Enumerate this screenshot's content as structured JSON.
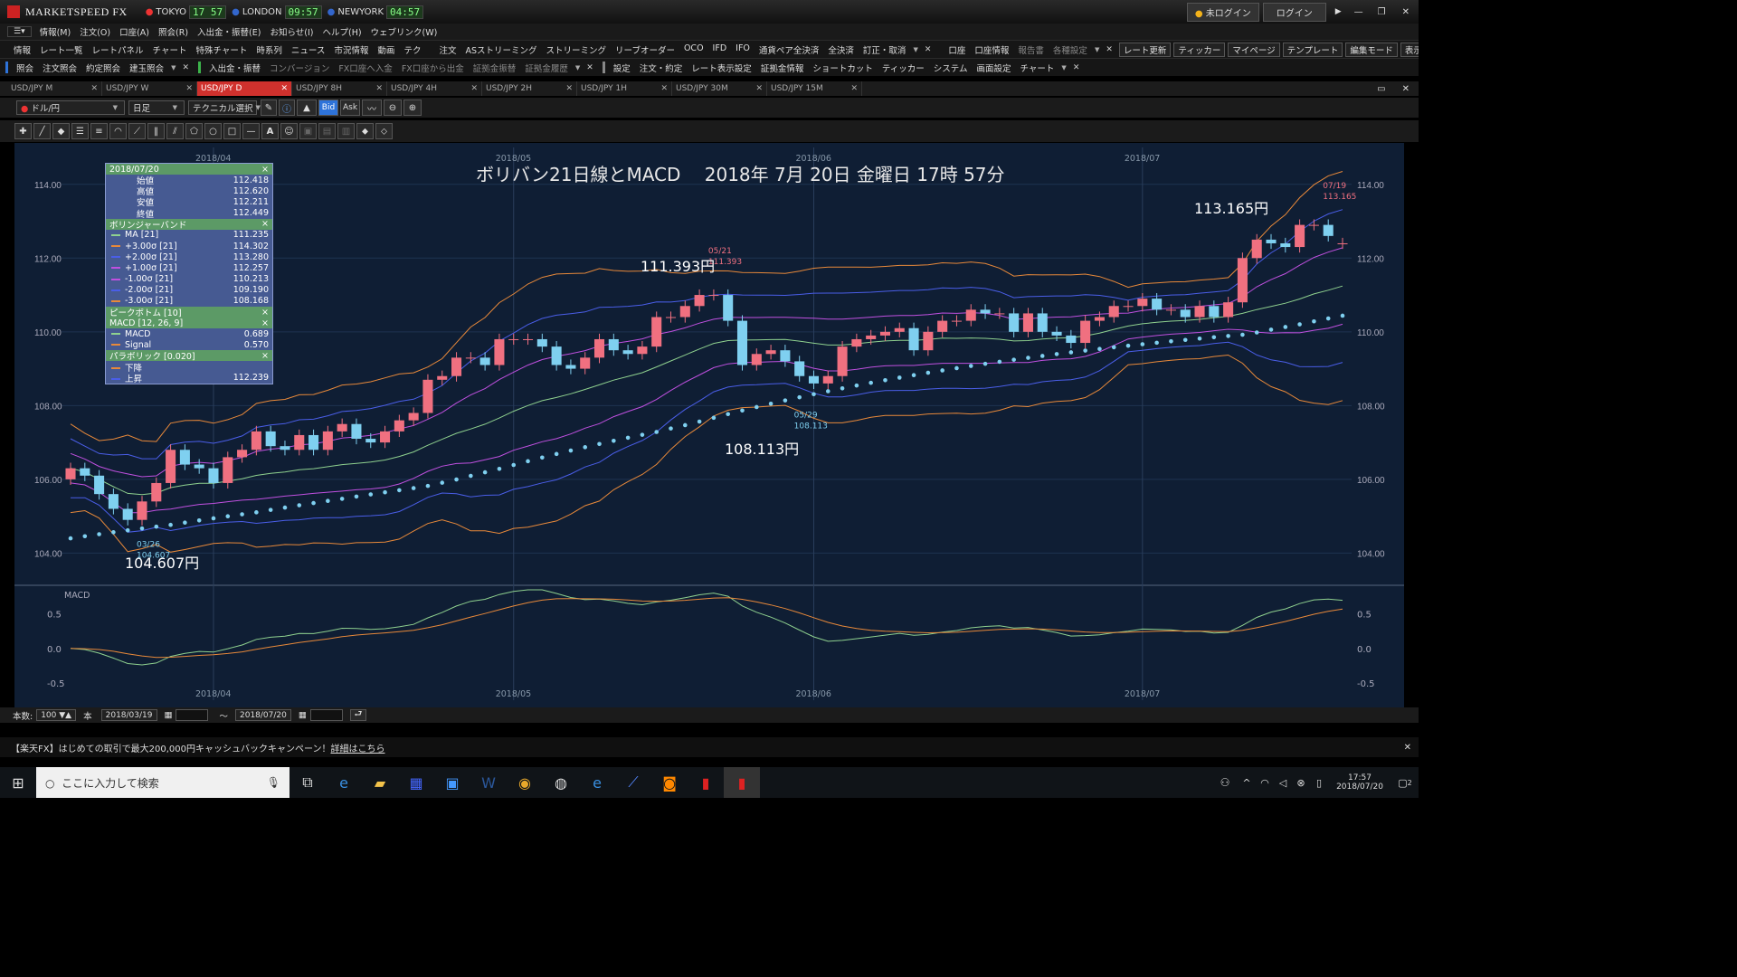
{
  "app": {
    "brand": "MARKETSPEED FX",
    "markets": [
      {
        "name": "TOKYO",
        "time": "17 57"
      },
      {
        "name": "LONDON",
        "time": "09:57"
      },
      {
        "name": "NEWYORK",
        "time": "04:57"
      }
    ],
    "status": "未ログイン",
    "login": "ログイン"
  },
  "menu": [
    "情報(M)",
    "注文(O)",
    "口座(A)",
    "照会(R)",
    "入出金・振替(E)",
    "お知らせ(I)",
    "ヘルプ(H)",
    "ウェブリンク(W)"
  ],
  "toolbar1": {
    "info": [
      "情報",
      "レート一覧",
      "レートパネル",
      "チャート",
      "特殊チャート",
      "時系列",
      "ニュース",
      "市況情報",
      "動画",
      "テク"
    ],
    "order": [
      "注文",
      "ASストリーミング",
      "ストリーミング",
      "リーブオーダー",
      "OCO",
      "IFD",
      "IFO",
      "通貨ペア全決済",
      "全決済",
      "訂正・取消"
    ],
    "account": [
      "口座",
      "口座情報",
      "報告書",
      "各種設定"
    ],
    "right": [
      "レート更新",
      "ティッカー",
      "マイページ",
      "テンプレート",
      "編集モード",
      "表示・環境設定"
    ]
  },
  "toolbar2": {
    "inquiry": [
      "照会",
      "注文照会",
      "約定照会",
      "建玉照会"
    ],
    "transfer": [
      "入出金・振替",
      "コンバージョン",
      "FX口座へ入金",
      "FX口座から出金",
      "証拠金振替",
      "証拠金履歴"
    ],
    "settings": [
      "設定",
      "注文・約定",
      "レート表示設定",
      "証拠金情報",
      "ショートカット",
      "ティッカー",
      "システム",
      "画面設定",
      "チャート"
    ]
  },
  "tabs": [
    "USD/JPY M",
    "USD/JPY W",
    "USD/JPY D",
    "USD/JPY 8H",
    "USD/JPY 4H",
    "USD/JPY 2H",
    "USD/JPY 1H",
    "USD/JPY 30M",
    "USD/JPY 15M"
  ],
  "active_tab": 2,
  "chart_controls": {
    "pair": "ドル/円",
    "period": "日足",
    "technical": "テクニカル選択",
    "bid": "Bid",
    "ask": "Ask"
  },
  "annotation": "ボリバン21日線とMACD　 2018年 7月 20日 金曜日 17時 57分",
  "callouts": {
    "high1": {
      "label": "111.393円",
      "date": "05/21",
      "value": "111.393"
    },
    "high2": {
      "label": "113.165円",
      "date": "07/19",
      "value": "113.165"
    },
    "low1": {
      "label": "104.607円",
      "date": "03/26",
      "value": "104.607"
    },
    "low2": {
      "label": "108.113円",
      "date": "05/29",
      "value": "108.113"
    }
  },
  "data_panel": {
    "ohlc": {
      "header": "2018/07/20",
      "rows": [
        [
          "始値",
          "112.418"
        ],
        [
          "高値",
          "112.620"
        ],
        [
          "安値",
          "112.211"
        ],
        [
          "終値",
          "112.449"
        ]
      ]
    },
    "bb": {
      "header": "ボリンジャーバンド",
      "rows": [
        [
          "MA [21]",
          "111.235",
          "#8fd18f"
        ],
        [
          "+3.00σ [21]",
          "114.302",
          "#e8893a"
        ],
        [
          "+2.00σ [21]",
          "113.280",
          "#4a5ee8"
        ],
        [
          "+1.00σ [21]",
          "112.257",
          "#c050e0"
        ],
        [
          "-1.00σ [21]",
          "110.213",
          "#c050e0"
        ],
        [
          "-2.00σ [21]",
          "109.190",
          "#4a5ee8"
        ],
        [
          "-3.00σ [21]",
          "108.168",
          "#e8893a"
        ]
      ]
    },
    "peak": {
      "header": "ピークボトム [10]"
    },
    "macd": {
      "header": "MACD [12, 26, 9]",
      "rows": [
        [
          "MACD",
          "0.689",
          "#8fd18f"
        ],
        [
          "Signal",
          "0.570",
          "#e8893a"
        ]
      ]
    },
    "sar": {
      "header": "パラボリック [0.020]",
      "rows": [
        [
          "下降",
          "",
          "#e8893a"
        ],
        [
          "上昇",
          "112.239",
          "#4a5ee8"
        ]
      ]
    }
  },
  "bottom": {
    "count_label": "本数:",
    "count": "100",
    "unit": "本",
    "from": "2018/03/19",
    "to": "2018/07/20",
    "tilde": "～"
  },
  "promo": {
    "text": "【楽天FX】はじめての取引で最大200,000円キャッシュバックキャンペーン！",
    "link": "詳細はこちら"
  },
  "taskbar": {
    "search": "ここに入力して検索",
    "time": "17:57",
    "date": "2018/07/20",
    "notif": "2"
  },
  "colors": {
    "up": "#f07080",
    "down": "#7fd0f0",
    "bg": "#0f1e34",
    "ma": "#8fd18f",
    "s3": "#e8893a",
    "s2": "#4a5ee8",
    "s1": "#c050e0"
  },
  "chart_data": {
    "type": "candlestick",
    "yticks": [
      "114.00",
      "112.00",
      "110.00",
      "108.00",
      "106.00",
      "104.00"
    ],
    "ylim": [
      103.2,
      115.0
    ],
    "xlabels": [
      "2018/04",
      "2018/05",
      "2018/06",
      "2018/07"
    ],
    "macd_label": "MACD",
    "macd_ticks": [
      "0.5",
      "0.0",
      "-0.5"
    ],
    "macd_ylim": [
      -0.75,
      0.85
    ],
    "dates": [
      "03/19",
      "03/20",
      "03/21",
      "03/22",
      "03/23",
      "03/26",
      "03/27",
      "03/28",
      "03/29",
      "03/30",
      "04/02",
      "04/03",
      "04/04",
      "04/05",
      "04/06",
      "04/09",
      "04/10",
      "04/11",
      "04/12",
      "04/13",
      "04/16",
      "04/17",
      "04/18",
      "04/19",
      "04/20",
      "04/23",
      "04/24",
      "04/25",
      "04/26",
      "04/27",
      "04/30",
      "05/01",
      "05/02",
      "05/03",
      "05/04",
      "05/07",
      "05/08",
      "05/09",
      "05/10",
      "05/11",
      "05/14",
      "05/15",
      "05/16",
      "05/17",
      "05/18",
      "05/21",
      "05/22",
      "05/23",
      "05/24",
      "05/25",
      "05/28",
      "05/29",
      "05/30",
      "05/31",
      "06/01",
      "06/04",
      "06/05",
      "06/06",
      "06/07",
      "06/08",
      "06/11",
      "06/12",
      "06/13",
      "06/14",
      "06/15",
      "06/18",
      "06/19",
      "06/20",
      "06/21",
      "06/22",
      "06/25",
      "06/26",
      "06/27",
      "06/28",
      "06/29",
      "07/02",
      "07/03",
      "07/04",
      "07/05",
      "07/06",
      "07/09",
      "07/10",
      "07/11",
      "07/12",
      "07/13",
      "07/16",
      "07/17",
      "07/18",
      "07/19",
      "07/20"
    ],
    "close": [
      106.3,
      106.1,
      105.6,
      105.2,
      104.9,
      105.4,
      105.9,
      106.8,
      106.4,
      106.3,
      105.9,
      106.6,
      106.8,
      107.3,
      106.9,
      106.8,
      107.2,
      106.8,
      107.3,
      107.5,
      107.1,
      107.0,
      107.3,
      107.6,
      107.8,
      108.7,
      108.8,
      109.3,
      109.3,
      109.1,
      109.8,
      109.8,
      109.8,
      109.6,
      109.1,
      109.0,
      109.3,
      109.8,
      109.5,
      109.4,
      109.6,
      110.4,
      110.4,
      110.7,
      111.0,
      111.0,
      110.3,
      109.1,
      109.4,
      109.5,
      109.2,
      108.8,
      108.6,
      108.8,
      109.6,
      109.8,
      109.9,
      110.0,
      110.1,
      109.5,
      110.0,
      110.3,
      110.3,
      110.6,
      110.5,
      110.5,
      110.0,
      110.5,
      110.0,
      109.9,
      109.7,
      110.3,
      110.4,
      110.7,
      110.7,
      110.9,
      110.6,
      110.6,
      110.4,
      110.7,
      110.4,
      110.8,
      112.0,
      112.5,
      112.4,
      112.3,
      112.9,
      112.9,
      112.6,
      112.4
    ],
    "open": [
      106.0,
      106.3,
      106.1,
      105.6,
      105.2,
      104.9,
      105.4,
      105.9,
      106.8,
      106.4,
      106.3,
      105.9,
      106.6,
      106.8,
      107.3,
      106.9,
      106.8,
      107.2,
      106.8,
      107.3,
      107.5,
      107.1,
      107.0,
      107.3,
      107.6,
      107.8,
      108.7,
      108.8,
      109.3,
      109.3,
      109.1,
      109.8,
      109.8,
      109.8,
      109.6,
      109.1,
      109.0,
      109.3,
      109.8,
      109.5,
      109.4,
      109.6,
      110.4,
      110.4,
      110.7,
      111.0,
      111.0,
      110.3,
      109.1,
      109.4,
      109.5,
      109.2,
      108.8,
      108.6,
      108.8,
      109.6,
      109.8,
      109.9,
      110.0,
      110.1,
      109.5,
      110.0,
      110.3,
      110.3,
      110.6,
      110.5,
      110.5,
      110.0,
      110.5,
      110.0,
      109.9,
      109.7,
      110.3,
      110.4,
      110.7,
      110.7,
      110.9,
      110.6,
      110.6,
      110.4,
      110.7,
      110.4,
      110.8,
      112.0,
      112.5,
      112.4,
      112.3,
      112.9,
      112.9,
      112.4
    ]
  }
}
